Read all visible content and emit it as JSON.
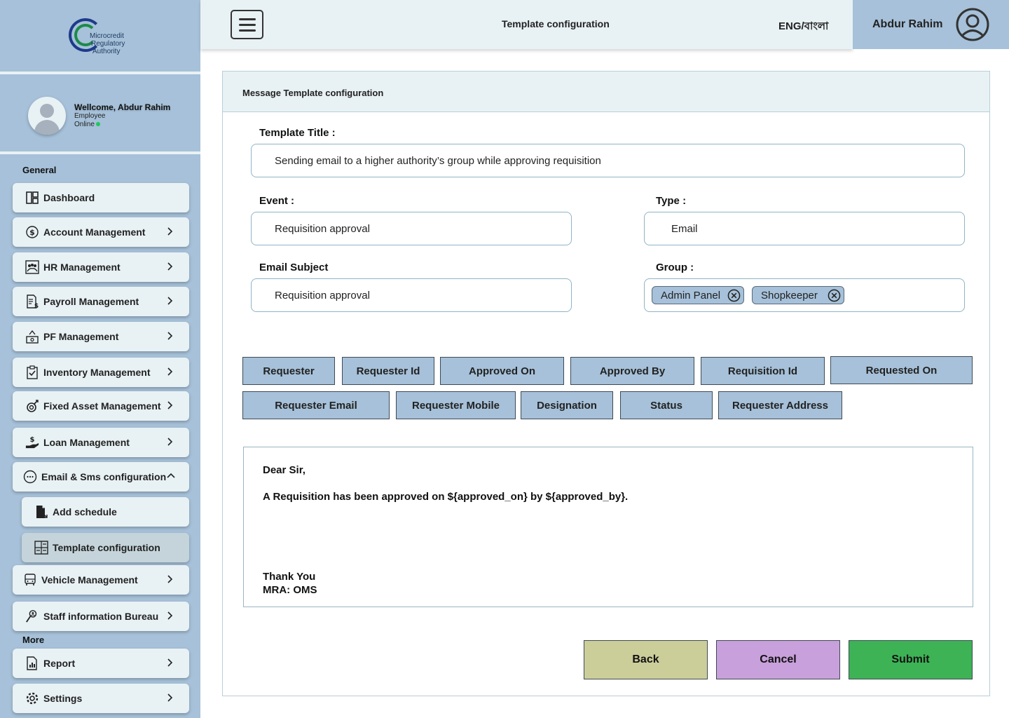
{
  "logo": {
    "lines": [
      "Microcredit",
      "Regulatory",
      "Authority"
    ]
  },
  "profile": {
    "welcome": "Wellcome, Abdur Rahim",
    "role": "Employee",
    "status": "Online"
  },
  "sidebar": {
    "general_label": "General",
    "more_label": "More",
    "items": [
      {
        "label": "Dashboard"
      },
      {
        "label": "Account Management"
      },
      {
        "label": "HR Management"
      },
      {
        "label": "Payroll Management"
      },
      {
        "label": "PF Management"
      },
      {
        "label": "Inventory Management"
      },
      {
        "label": "Fixed Asset Management"
      },
      {
        "label": "Loan Management"
      },
      {
        "label": "Email & Sms configuration"
      },
      {
        "label": "Add schedule"
      },
      {
        "label": "Template configuration"
      },
      {
        "label": "Vehicle Management"
      },
      {
        "label": "Staff information Bureau"
      },
      {
        "label": "Report"
      },
      {
        "label": "Settings"
      }
    ]
  },
  "header": {
    "title": "Template configuration",
    "language": "ENG/বাংলা",
    "user_name": "Abdur Rahim"
  },
  "form": {
    "card_title": "Message Template configuration",
    "template_title_label": "Template Title :",
    "template_title_value": "Sending email to a higher authority’s group while approving requisition",
    "event_label": "Event :",
    "event_value": "Requisition approval",
    "type_label": "Type :",
    "type_value": "Email",
    "subject_label": "Email Subject",
    "subject_value": "Requisition approval",
    "group_label": "Group :",
    "groups": [
      "Admin Panel",
      "Shopkeeper"
    ]
  },
  "placeholders": [
    "Requester",
    "Requester Id",
    "Approved On",
    "Approved By",
    "Requisition Id",
    "Requested On",
    "Requester Email",
    "Requester Mobile",
    "Designation",
    "Status",
    "Requester Address"
  ],
  "message": {
    "greeting": "Dear Sir,",
    "line": "A Requisition has been approved on ${approved_on} by ${approved_by}.",
    "closing": "Thank You",
    "signature": "MRA: OMS"
  },
  "actions": {
    "back": "Back",
    "cancel": "Cancel",
    "submit": "Submit"
  },
  "colors": {
    "back": "#cbce99",
    "cancel": "#c8a0db",
    "submit": "#3db356",
    "sidebar": "#a6c1d9",
    "panel": "#e8f1f4"
  }
}
